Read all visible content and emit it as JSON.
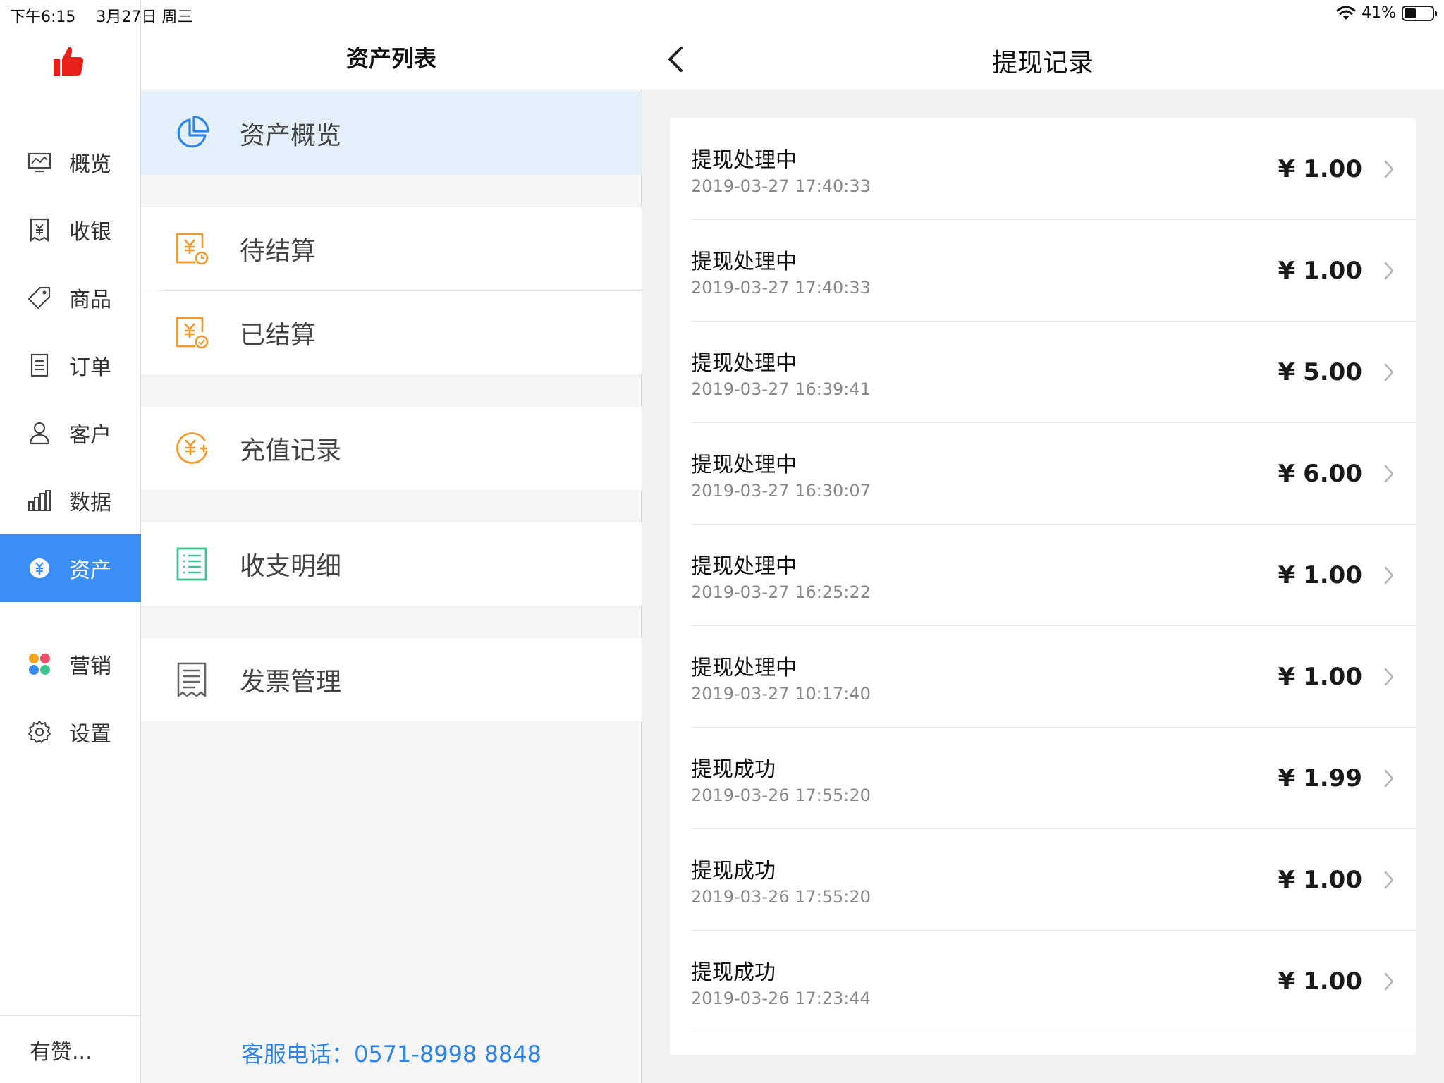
{
  "status_bar": {
    "time": "下午6:15",
    "date": "3月27日 周三",
    "battery": "41%",
    "battery_level": 0.41
  },
  "rail": {
    "items": [
      {
        "label": "概览",
        "icon": "monitor-icon"
      },
      {
        "label": "收银",
        "icon": "cashier-icon"
      },
      {
        "label": "商品",
        "icon": "tag-icon"
      },
      {
        "label": "订单",
        "icon": "document-icon"
      },
      {
        "label": "客户",
        "icon": "user-icon"
      },
      {
        "label": "数据",
        "icon": "bar-chart-icon"
      },
      {
        "label": "资产",
        "icon": "yuan-coin-icon",
        "active": true
      },
      {
        "label": "营销",
        "icon": "four-dots-icon"
      },
      {
        "label": "设置",
        "icon": "gear-icon"
      }
    ],
    "footer": "有赞..."
  },
  "middle": {
    "title": "资产列表",
    "items": [
      {
        "label": "资产概览",
        "icon": "pie-chart-icon",
        "selected": true
      },
      {
        "label": "待结算",
        "icon": "pending-settle-icon"
      },
      {
        "label": "已结算",
        "icon": "settled-icon"
      },
      {
        "label": "充值记录",
        "icon": "recharge-icon"
      },
      {
        "label": "收支明细",
        "icon": "list-icon"
      },
      {
        "label": "发票管理",
        "icon": "invoice-icon"
      }
    ],
    "service": "客服电话：0571-8998 8848"
  },
  "right": {
    "title": "提现记录",
    "records": [
      {
        "status": "提现处理中",
        "time": "2019-03-27 17:40:33",
        "amount": "¥ 1.00"
      },
      {
        "status": "提现处理中",
        "time": "2019-03-27 17:40:33",
        "amount": "¥ 1.00"
      },
      {
        "status": "提现处理中",
        "time": "2019-03-27 16:39:41",
        "amount": "¥ 5.00"
      },
      {
        "status": "提现处理中",
        "time": "2019-03-27 16:30:07",
        "amount": "¥ 6.00"
      },
      {
        "status": "提现处理中",
        "time": "2019-03-27 16:25:22",
        "amount": "¥ 1.00"
      },
      {
        "status": "提现处理中",
        "time": "2019-03-27 10:17:40",
        "amount": "¥ 1.00"
      },
      {
        "status": "提现成功",
        "time": "2019-03-26 17:55:20",
        "amount": "¥ 1.99"
      },
      {
        "status": "提现成功",
        "time": "2019-03-26 17:55:20",
        "amount": "¥ 1.00"
      },
      {
        "status": "提现成功",
        "time": "2019-03-26 17:23:44",
        "amount": "¥ 1.00"
      }
    ]
  },
  "colors": {
    "accent": "#3a8ef6",
    "selected_bg": "#e3effb",
    "orange_icon": "#f29a2e",
    "green_icon": "#3cc38f",
    "service_link": "#2f83e4"
  }
}
